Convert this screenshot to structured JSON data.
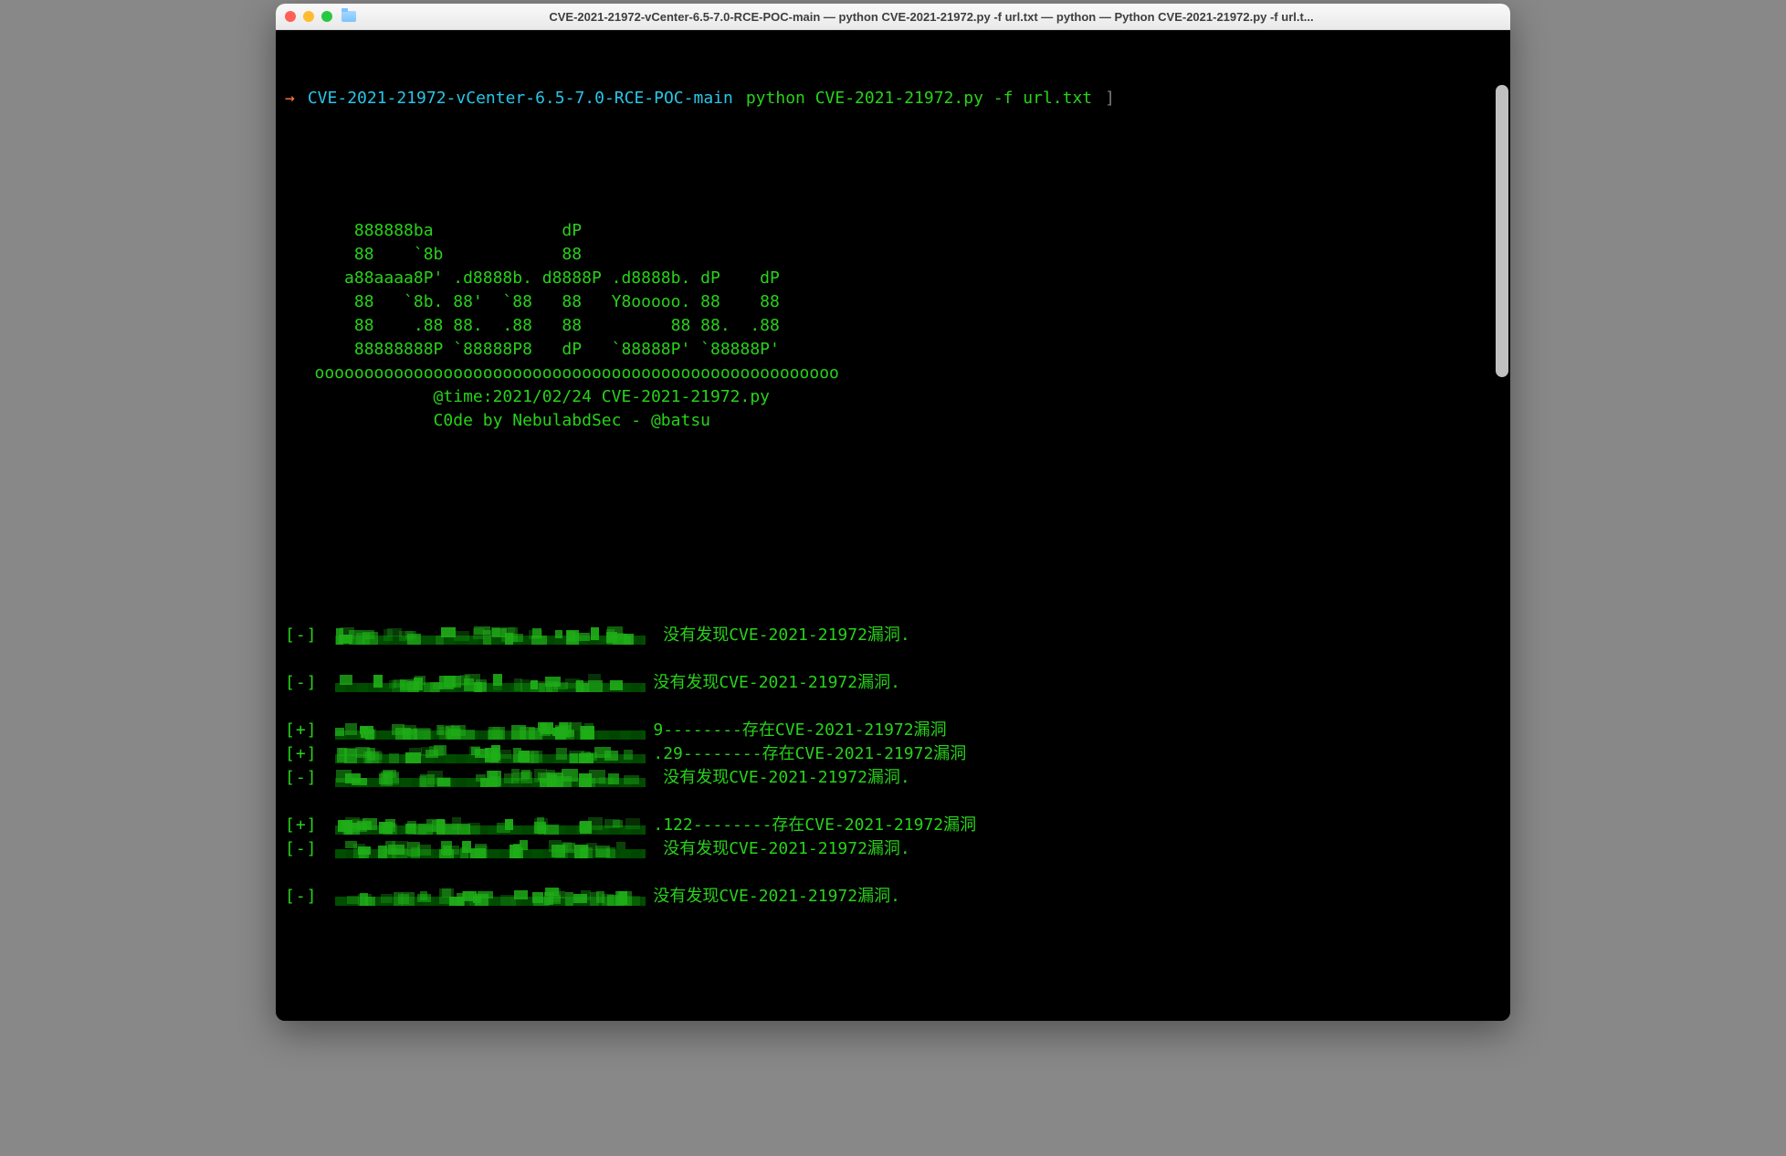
{
  "window": {
    "title": "CVE-2021-21972-vCenter-6.5-7.0-RCE-POC-main — python CVE-2021-21972.py -f url.txt — python — Python CVE-2021-21972.py -f url.t..."
  },
  "prompt": {
    "arrow": "→",
    "cwd": "CVE-2021-21972-vCenter-6.5-7.0-RCE-POC-main",
    "command": "python CVE-2021-21972.py -f url.txt",
    "cursor": "]"
  },
  "banner": {
    "l1": "       888888ba             dP",
    "l2": "       88    `8b            88",
    "l3": "      a88aaaa8P' .d8888b. d8888P .d8888b. dP    dP",
    "l4": "       88   `8b. 88'  `88   88   Y8ooooo. 88    88",
    "l5": "       88    .88 88.  .88   88         88 88.  .88",
    "l6": "       88888888P `88888P8   dP   `88888P' `88888P'",
    "l7": "   ooooooooooooooooooooooooooooooooooooooooooooooooooooo",
    "l8": "               @time:2021/02/24 CVE-2021-21972.py",
    "l9": "               C0de by NebulabdSec - @batsu"
  },
  "results": [
    {
      "tag": "[-]",
      "trail": " 没有发现CVE-2021-21972漏洞."
    },
    {
      "tag": "",
      "trail": ""
    },
    {
      "tag": "[-]",
      "trail": "没有发现CVE-2021-21972漏洞."
    },
    {
      "tag": "",
      "trail": ""
    },
    {
      "tag": "[+]",
      "trail": "9--------存在CVE-2021-21972漏洞"
    },
    {
      "tag": "[+]",
      "trail": ".29--------存在CVE-2021-21972漏洞"
    },
    {
      "tag": "[-]",
      "trail": " 没有发现CVE-2021-21972漏洞."
    },
    {
      "tag": "",
      "trail": ""
    },
    {
      "tag": "[+]",
      "trail": ".122--------存在CVE-2021-21972漏洞"
    },
    {
      "tag": "[-]",
      "trail": " 没有发现CVE-2021-21972漏洞."
    },
    {
      "tag": "",
      "trail": ""
    },
    {
      "tag": "[-]",
      "trail": "没有发现CVE-2021-21972漏洞."
    }
  ]
}
